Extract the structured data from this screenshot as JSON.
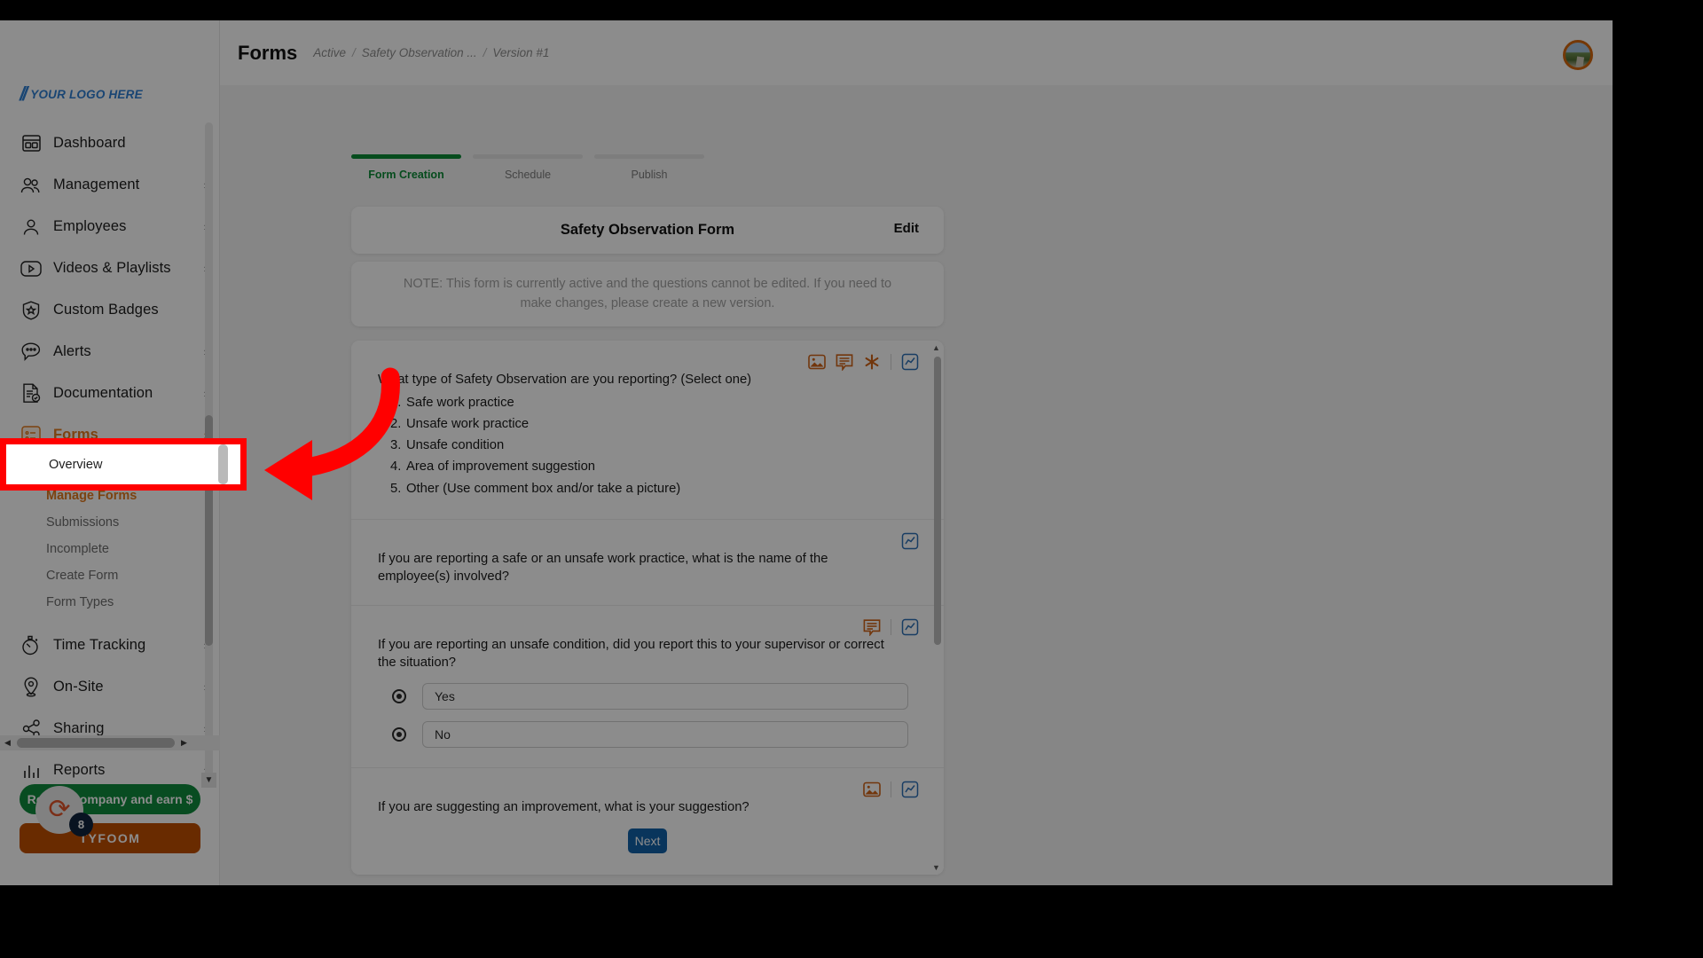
{
  "brand": {
    "logo_text": "YOUR LOGO HERE",
    "logo_color": "#2f7fd1"
  },
  "header": {
    "title": "Forms",
    "breadcrumb": [
      "Active",
      "Safety Observation ...",
      "Version #1"
    ],
    "separator": "/"
  },
  "sidebar": {
    "items": [
      {
        "label": "Dashboard",
        "icon": "dashboard-icon",
        "expandable": false
      },
      {
        "label": "Management",
        "icon": "people-icon",
        "expandable": true
      },
      {
        "label": "Employees",
        "icon": "person-icon",
        "expandable": true
      },
      {
        "label": "Videos & Playlists",
        "icon": "video-play-icon",
        "expandable": true
      },
      {
        "label": "Custom Badges",
        "icon": "shield-star-icon",
        "expandable": false
      },
      {
        "label": "Alerts",
        "icon": "alert-bubble-icon",
        "expandable": true
      },
      {
        "label": "Documentation",
        "icon": "document-check-icon",
        "expandable": true
      },
      {
        "label": "Forms",
        "icon": "form-list-icon",
        "expandable": true,
        "active": true
      },
      {
        "label": "Time Tracking",
        "icon": "stopwatch-icon",
        "expandable": true
      },
      {
        "label": "On-Site",
        "icon": "map-pin-icon",
        "expandable": true
      },
      {
        "label": "Sharing",
        "icon": "share-icon",
        "expandable": true
      },
      {
        "label": "Reports",
        "icon": "bar-chart-icon",
        "expandable": true
      }
    ],
    "forms_submenu": [
      {
        "label": "Overview",
        "highlighted": true
      },
      {
        "label": "Manage Forms"
      },
      {
        "label": "Submissions"
      },
      {
        "label": "Incomplete"
      },
      {
        "label": "Create Form"
      },
      {
        "label": "Form Types"
      }
    ],
    "promo": {
      "green_label": "Refer a company and earn $",
      "orange_label": "TYFOOM",
      "badge_count": "8",
      "badge_icon": "tyfoom-swirl-icon"
    }
  },
  "stepper": {
    "steps": [
      {
        "label": "Form Creation",
        "state": "done"
      },
      {
        "label": "Schedule",
        "state": "todo"
      },
      {
        "label": "Publish",
        "state": "todo"
      }
    ]
  },
  "form": {
    "title": "Safety Observation Form",
    "edit_label": "Edit",
    "note": "NOTE: This form is currently active and the questions cannot be edited. If you need to make changes, please create a new version.",
    "next_label": "Next",
    "questions": [
      {
        "text": "What type of Safety Observation are you reporting? (Select one)",
        "tools": [
          "image-icon",
          "comment-icon",
          "required-asterisk-icon",
          "analytics-icon"
        ],
        "options": [
          {
            "num": "1.",
            "label": "Safe work practice"
          },
          {
            "num": "2.",
            "label": "Unsafe work practice"
          },
          {
            "num": "3.",
            "label": "Unsafe condition"
          },
          {
            "num": "4.",
            "label": "Area of improvement suggestion"
          },
          {
            "num": "5.",
            "label": "Other (Use comment box and/or take a picture)"
          }
        ]
      },
      {
        "text": "If you are reporting a safe or an unsafe work practice, what is the name of the employee(s) involved?",
        "tools": [
          "analytics-icon"
        ],
        "options": []
      },
      {
        "text": "If you are reporting an unsafe condition, did you report this to your supervisor or correct the situation?",
        "tools": [
          "comment-icon",
          "analytics-icon"
        ],
        "radios": [
          "Yes",
          "No"
        ]
      },
      {
        "text": "If you are suggesting an improvement, what is your suggestion?",
        "tools": [
          "image-icon",
          "analytics-icon"
        ],
        "options": []
      }
    ]
  },
  "annotation": {
    "highlight_color": "#ff0000",
    "arrow_color": "#ff0000",
    "target": "Overview"
  },
  "colors": {
    "accent_orange": "#e07a1f",
    "step_green": "#0b8a36",
    "button_blue": "#1262a8",
    "promo_green": "#108a3d",
    "promo_orange": "#c04f00"
  }
}
